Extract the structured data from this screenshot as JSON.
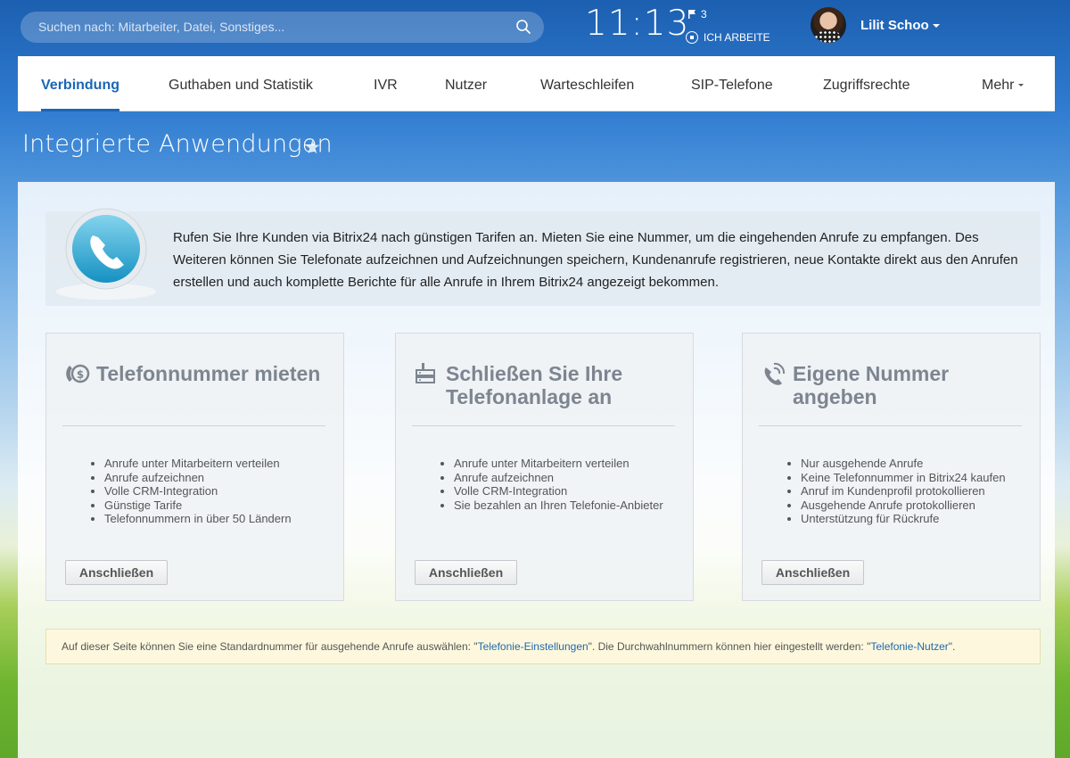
{
  "header": {
    "search_placeholder": "Suchen nach: Mitarbeiter, Datei, Sonstiges...",
    "clock": "11:13",
    "flag_count": "3",
    "work_status": "ICH ARBEITE",
    "user_name": "Lilit Schoo"
  },
  "tabs": [
    {
      "label": "Verbindung",
      "active": true
    },
    {
      "label": "Guthaben und Statistik"
    },
    {
      "label": "IVR"
    },
    {
      "label": "Nutzer"
    },
    {
      "label": "Warteschleifen"
    },
    {
      "label": "SIP-Telefone"
    },
    {
      "label": "Zugriffsrechte"
    },
    {
      "label": "Mehr"
    }
  ],
  "page": {
    "title": "Integrierte Anwendungen"
  },
  "intro": {
    "text": "Rufen Sie Ihre Kunden via Bitrix24 nach günstigen Tarifen an. Mieten Sie eine Nummer, um die eingehenden Anrufe zu empfangen. Des Weiteren können Sie Telefonate aufzeichnen und Aufzeichnungen speichern, Kundenanrufe registrieren, neue Kontakte direkt aus den Anrufen erstellen und auch komplette Berichte für alle Anrufe in Ihrem Bitrix24 angezeigt bekommen."
  },
  "cards": [
    {
      "title": "Telefonnummer mieten",
      "icon": "rent-number-icon",
      "items": [
        "Anrufe unter Mitarbeitern verteilen",
        "Anrufe aufzeichnen",
        "Volle CRM-Integration",
        "Günstige Tarife",
        "Telefonnummern in über 50 Ländern"
      ],
      "button": "Anschließen"
    },
    {
      "title": "Schließen Sie Ihre Telefonanlage an",
      "icon": "pbx-icon",
      "items": [
        "Anrufe unter Mitarbeitern verteilen",
        "Anrufe aufzeichnen",
        "Volle CRM-Integration",
        "Sie bezahlen an Ihren Telefonie-Anbieter"
      ],
      "button": "Anschließen"
    },
    {
      "title": "Eigene Nummer angeben",
      "icon": "callback-phone-icon",
      "items": [
        "Nur ausgehende Anrufe",
        "Keine Telefonnummer in Bitrix24 kaufen",
        "Anruf im Kundenprofil protokollieren",
        "Ausgehende Anrufe protokollieren",
        "Unterstützung für Rückrufe"
      ],
      "button": "Anschließen"
    }
  ],
  "notice": {
    "text_1": "Auf dieser Seite können Sie eine Standardnummer für ausgehende Anrufe auswählen: \"",
    "link_1": "Telefonie-Einstellungen",
    "text_2": "\". Die Durchwahlnummern können hier eingestellt werden: \"",
    "link_2": "Telefonie-Nutzer",
    "text_3": "\"."
  }
}
